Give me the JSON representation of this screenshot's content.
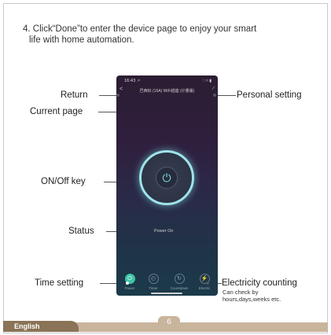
{
  "instruction": {
    "line1": "4. Click“Done”to enter the device page to enjoy your smart",
    "line2": "life with home automation."
  },
  "annotations": {
    "return": "Return",
    "current_page": "Current page",
    "personal_setting": "Personal setting",
    "on_off_key": "ON/Off key",
    "status": "Status",
    "time_setting": "Time setting",
    "electricity_counting": "Electricity counting",
    "electricity_note_1": "Can check by",
    "electricity_note_2": "hours,days,weeks etc."
  },
  "phone": {
    "status_time": "16:43 ↗",
    "status_icons": "∷ ≈ ▮",
    "back_symbol": "<",
    "title": "巴西标 (16A) WiFi插座 (计量版)",
    "edit_symbol": "∕",
    "power_symbol": "⏻",
    "status_text": "Power On",
    "tabs": [
      {
        "icon": "power-icon",
        "glyph": "⏻",
        "label": "Power"
      },
      {
        "icon": "timer-icon",
        "glyph": "◴",
        "label": "Timer"
      },
      {
        "icon": "countdown-icon",
        "glyph": "↻",
        "label": "Countdown"
      },
      {
        "icon": "electric-icon",
        "glyph": "⚡",
        "label": "Electric"
      }
    ]
  },
  "footer": {
    "language": "English",
    "page_number": "6"
  },
  "colors": {
    "accent": "#3fc4a8",
    "ring": "#9fe3e8",
    "footer": "#c9b49c",
    "footer_tab": "#8a7356"
  }
}
